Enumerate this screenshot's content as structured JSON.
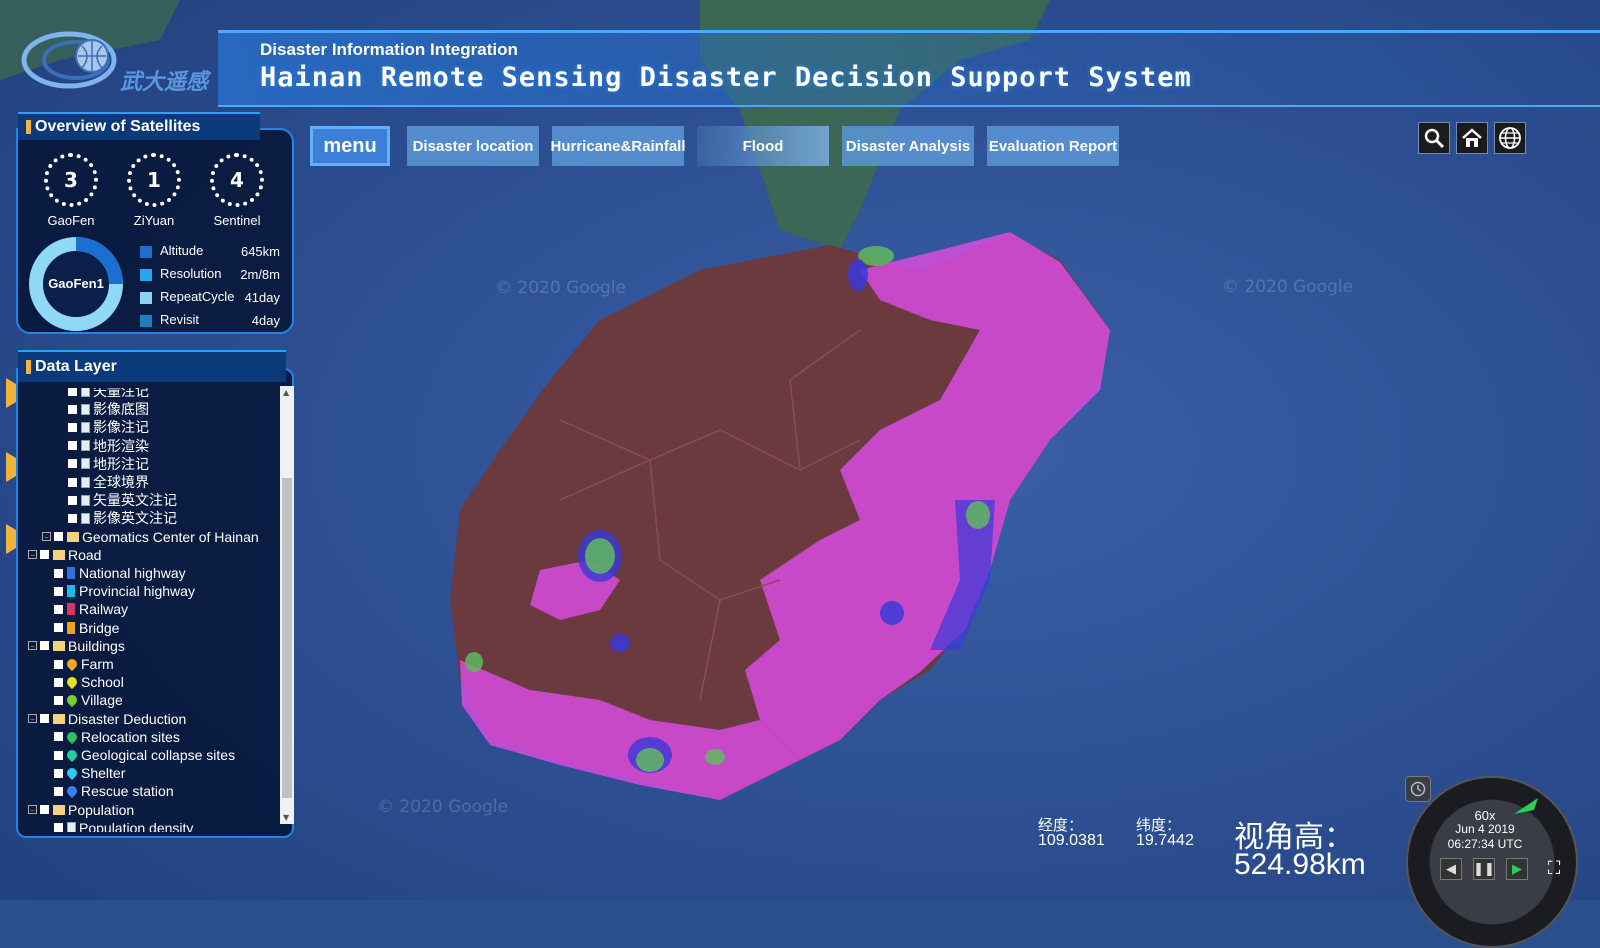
{
  "header": {
    "logo_text": "武大遥感",
    "subtitle": "Disaster Information Integration",
    "title": "Hainan Remote Sensing Disaster Decision Support System"
  },
  "nav": {
    "menu": "menu",
    "items": [
      "Disaster location",
      "Hurricane&Rainfall",
      "Flood",
      "Disaster Analysis",
      "Evaluation Report"
    ]
  },
  "toolbar": {
    "icons": [
      "search-icon",
      "home-icon",
      "globe-icon"
    ]
  },
  "satellites_panel": {
    "title": "Overview of Satellites",
    "satellites": [
      {
        "count": "3",
        "name": "GaoFen"
      },
      {
        "count": "1",
        "name": "ZiYuan"
      },
      {
        "count": "4",
        "name": "Sentinel"
      }
    ],
    "donut_label": "GaoFen1",
    "stats": [
      {
        "label": "Altitude",
        "value": "645km",
        "color": "#1a6fd0"
      },
      {
        "label": "Resolution",
        "value": "2m/8m",
        "color": "#23a7f0"
      },
      {
        "label": "RepeatCycle",
        "value": "41day",
        "color": "#8fd0f5"
      },
      {
        "label": "Revisit",
        "value": "4day",
        "color": "#1f7fb8"
      }
    ]
  },
  "data_layer_panel": {
    "title": "Data Layer",
    "tree": [
      {
        "label": "矢量注记",
        "kind": "doc",
        "level": 3
      },
      {
        "label": "影像底图",
        "kind": "doc",
        "level": 3
      },
      {
        "label": "影像注记",
        "kind": "doc",
        "level": 3
      },
      {
        "label": "地形渲染",
        "kind": "doc",
        "level": 3
      },
      {
        "label": "地形注记",
        "kind": "doc",
        "level": 3
      },
      {
        "label": "全球境界",
        "kind": "doc",
        "level": 3
      },
      {
        "label": "矢量英文注记",
        "kind": "doc",
        "level": 3
      },
      {
        "label": "影像英文注记",
        "kind": "doc",
        "level": 3
      },
      {
        "label": "Geomatics Center of Hainan",
        "kind": "folder",
        "level": 2
      },
      {
        "label": "Road",
        "kind": "folder",
        "level": 1
      },
      {
        "label": "National highway",
        "kind": "line",
        "color": "#2f6fe0",
        "level": 2
      },
      {
        "label": "Provincial highway",
        "kind": "line",
        "color": "#20b8e8",
        "level": 2
      },
      {
        "label": "Railway",
        "kind": "line",
        "color": "#e0306a",
        "level": 2
      },
      {
        "label": "Bridge",
        "kind": "line",
        "color": "#f0a020",
        "level": 2
      },
      {
        "label": "Buildings",
        "kind": "folder",
        "level": 1
      },
      {
        "label": "Farm",
        "kind": "pin",
        "color": "#f5a623",
        "level": 2
      },
      {
        "label": "School",
        "kind": "pin",
        "color": "#e8e020",
        "level": 2
      },
      {
        "label": "Village",
        "kind": "pin",
        "color": "#7ad030",
        "level": 2
      },
      {
        "label": "Disaster Deduction",
        "kind": "folder",
        "level": 1
      },
      {
        "label": "Relocation sites",
        "kind": "pin",
        "color": "#30c060",
        "level": 2
      },
      {
        "label": "Geological collapse sites",
        "kind": "pin",
        "color": "#20d0a0",
        "level": 2
      },
      {
        "label": "Shelter",
        "kind": "pin",
        "color": "#30c8f0",
        "level": 2
      },
      {
        "label": "Rescue station",
        "kind": "pin",
        "color": "#3a80f0",
        "level": 2
      },
      {
        "label": "Population",
        "kind": "folder",
        "level": 1
      },
      {
        "label": "Population density",
        "kind": "doc",
        "level": 2
      }
    ]
  },
  "map": {
    "watermark": "© 2020 Google",
    "longitude_label": "经度：",
    "longitude": "109.0381",
    "latitude_label": "纬度：",
    "latitude": "19.7442",
    "camera_height_label": "视角高：",
    "camera_height": "524.98km"
  },
  "timeline": {
    "speed": "60x",
    "date": "Jun 4 2019",
    "time": "06:27:34 UTC"
  },
  "colors": {
    "flood_zone": "#d74ce0",
    "land": "#6a3a3a",
    "ocean": "#2e57a0",
    "accent": "#1f86e8"
  }
}
